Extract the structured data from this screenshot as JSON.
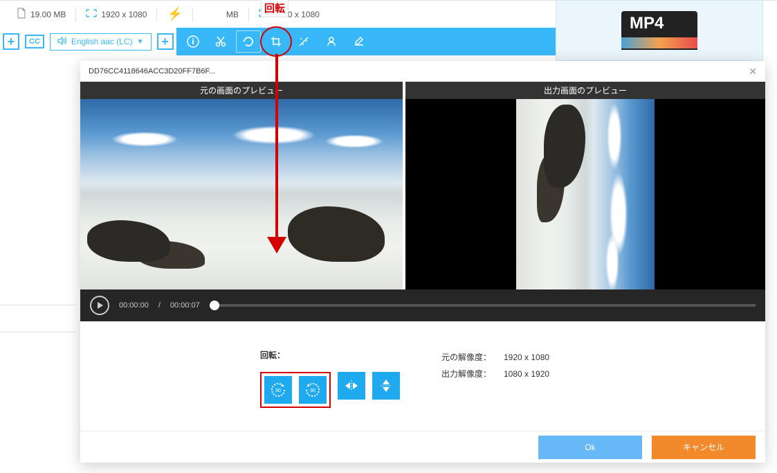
{
  "top": {
    "file_size": "19.00 MB",
    "dim1": "1920 x 1080",
    "file_size2_suffix": "MB",
    "dim2": "1920 x 1080"
  },
  "callout": {
    "rotate_label": "回転"
  },
  "audio": {
    "label": "English aac (LC)"
  },
  "side": {
    "format_badge": "MP4"
  },
  "dialog": {
    "title": "DD76CC4118646ACC3D20FF7B6F...",
    "preview_original": "元の画面のプレビュー",
    "preview_output": "出力画面のプレビュー",
    "time_current": "00:00:00",
    "time_total": "00:00:07",
    "rotate_section": "回転：",
    "res_original_label": "元の解像度：",
    "res_original_value": "1920 x 1080",
    "res_output_label": "出力解像度：",
    "res_output_value": "1080 x 1920",
    "ok": "Ok",
    "cancel": "キャンセル"
  }
}
